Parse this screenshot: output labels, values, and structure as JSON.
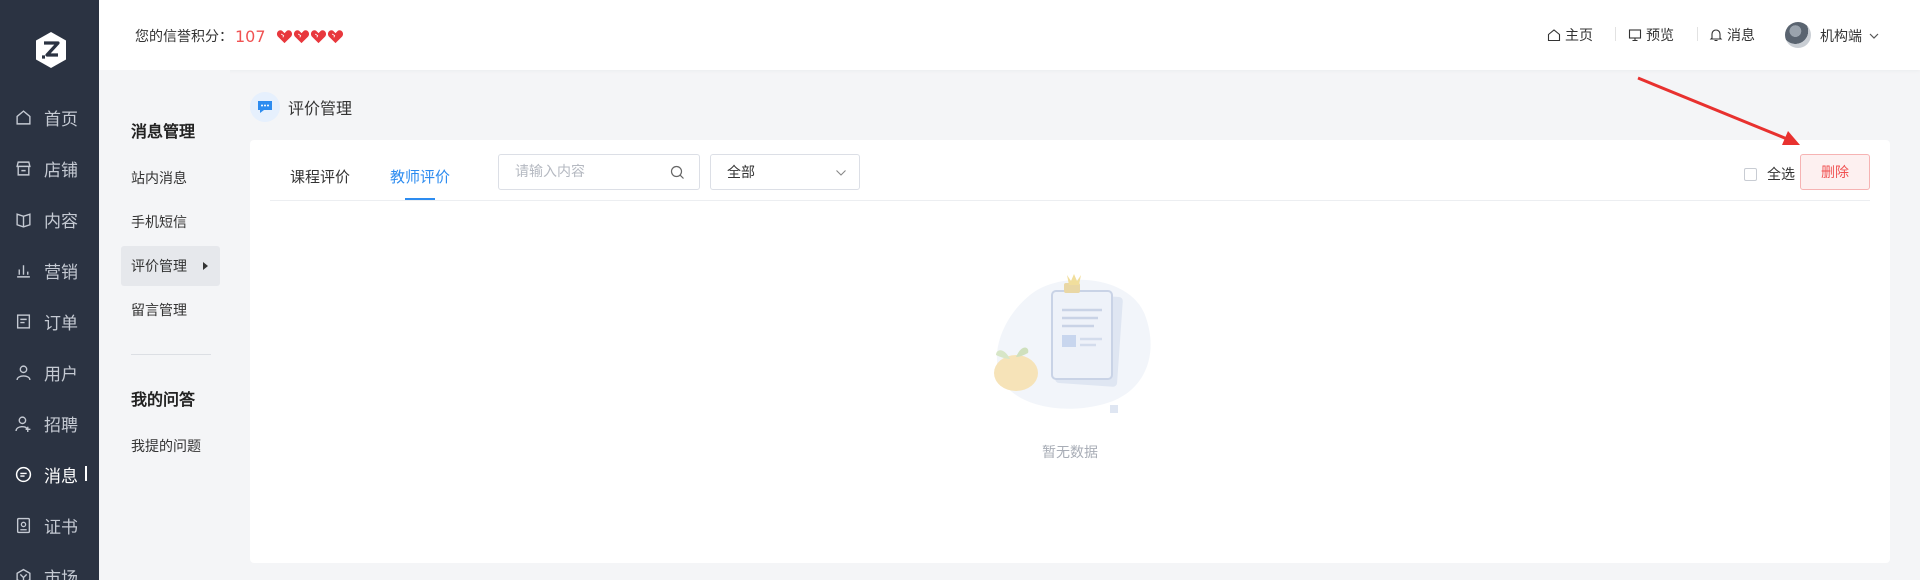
{
  "nav": {
    "logo_letter": "Z",
    "items": [
      {
        "label": "首页",
        "icon": "home-icon"
      },
      {
        "label": "店铺",
        "icon": "store-icon"
      },
      {
        "label": "内容",
        "icon": "book-icon"
      },
      {
        "label": "营销",
        "icon": "bar-chart-icon"
      },
      {
        "label": "订单",
        "icon": "order-icon"
      },
      {
        "label": "用户",
        "icon": "user-icon"
      },
      {
        "label": "招聘",
        "icon": "user-add-icon"
      },
      {
        "label": "消息",
        "icon": "message-icon",
        "active": true
      },
      {
        "label": "证书",
        "icon": "certificate-icon"
      },
      {
        "label": "市场",
        "icon": "market-icon"
      }
    ]
  },
  "header": {
    "credit_label": "您的信誉积分：",
    "credit_score": "107",
    "hearts": 4,
    "links": {
      "home": "主页",
      "preview": "预览",
      "message": "消息"
    },
    "user": "机构端"
  },
  "side": {
    "group1": "消息管理",
    "items1": [
      "站内消息",
      "手机短信",
      "评价管理",
      "留言管理"
    ],
    "active": "评价管理",
    "group2": "我的问答",
    "items2": [
      "我提的问题"
    ]
  },
  "page": {
    "title": "评价管理"
  },
  "tabs": {
    "course": "课程评价",
    "teacher": "教师评价",
    "active": "教师评价"
  },
  "search": {
    "placeholder": "请输入内容",
    "value": ""
  },
  "filter": {
    "selected": "全部"
  },
  "actions": {
    "select_all": "全选",
    "delete": "删除"
  },
  "empty": {
    "text": "暂无数据"
  },
  "colors": {
    "accent": "#2d8cf0",
    "danger": "#f05252",
    "nav_bg": "#2b3342",
    "heart": "#e8383d"
  }
}
